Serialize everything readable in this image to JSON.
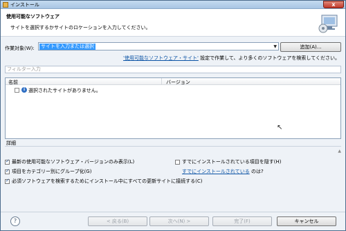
{
  "window": {
    "title": "インストール",
    "close_label": "x"
  },
  "banner": {
    "heading": "使用可能なソフトウェア",
    "description": "サイトを選択するかサイトのロケーションを入力してください。"
  },
  "work_with": {
    "label": "作業対象(W):",
    "value": "サイトを入力または選択",
    "add_button": "追加(A)..."
  },
  "hint": {
    "link": "'使用可能なソフトウェア・サイト'",
    "text": " 設定で作業して、より多くのソフトウェアを検索してください。"
  },
  "filter": {
    "placeholder": "フィルター入力"
  },
  "table": {
    "columns": [
      "名前",
      "バージョン"
    ],
    "rows": [
      {
        "name": "選択されたサイトがありません。"
      }
    ]
  },
  "details": {
    "label": "詳細"
  },
  "options": {
    "latest_only": "最新の使用可能なソフトウェア・バージョンのみ表示(L)",
    "hide_installed": "すでにインストールされている項目を隠す(H)",
    "group_by_category": "項目をカテゴリー別にグループ化(G)",
    "already_installed_link": "すでにインストールされている",
    "already_installed_suffix": " のは?",
    "contact_sites": "必須ソフトウェアを検索するためにインストール中にすべての更新サイトに接続する(C)"
  },
  "footer": {
    "help": "?",
    "back": "< 戻る(B)",
    "next": "次へ(N) >",
    "finish": "完了(F)",
    "cancel": "キャンセル"
  },
  "colors": {
    "selection": "#3399ff",
    "link": "#0b53a5"
  }
}
